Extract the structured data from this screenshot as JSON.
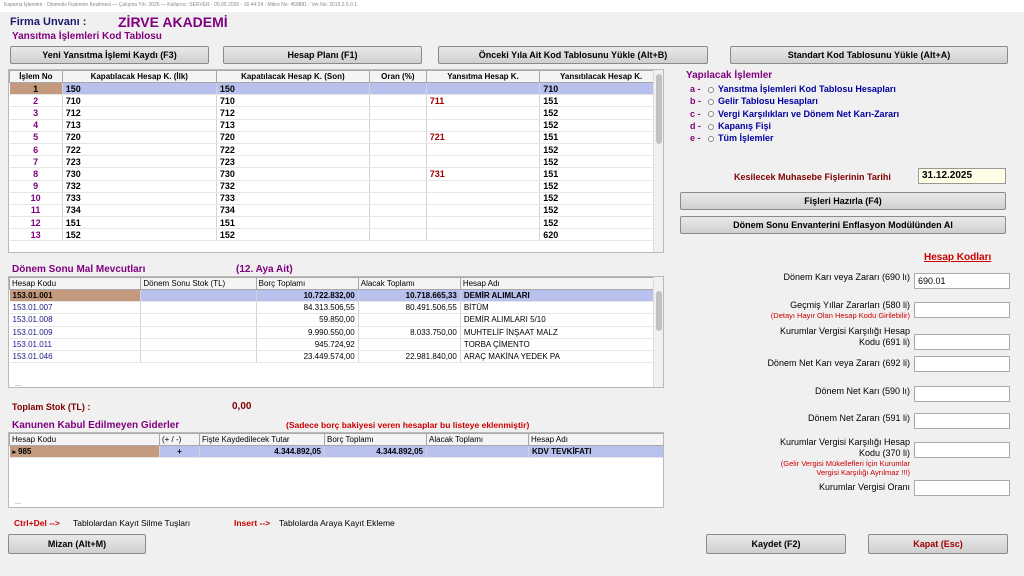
{
  "window": {
    "title": "Kapanış İşlemleri - Otomotiv Fişlerinin Kesilmesi  —  Çalışma Yılı: 2025  —  Kullanıcı: SERVER - 05.05.2026 - 16:44:24 - Mikro No: 459881 - Ver.No: 2015.2.5.0.1"
  },
  "header": {
    "firma_label": "Firma Unvanı :",
    "firma_value": "ZİRVE AKADEMİ",
    "section_title": "Yansıtma İşlemleri Kod Tablosu"
  },
  "toolbar": {
    "new_btn": "Yeni Yansıtma İşlemi Kaydı (F3)",
    "plan_btn": "Hesap Planı (F1)",
    "prev_btn": "Önceki Yıla Ait Kod Tablosunu Yükle (Alt+B)",
    "std_btn": "Standart Kod Tablosunu Yükle (Alt+A)"
  },
  "kod_tablosu": {
    "columns": [
      "İşlem No",
      "Kapatılacak Hesap K. (İlk)",
      "Kapatılacak Hesap K. (Son)",
      "Oran (%)",
      "Yansıtma Hesap K.",
      "Yansıtılacak Hesap K."
    ],
    "rows": [
      [
        "1",
        "150",
        "150",
        "",
        "",
        "710"
      ],
      [
        "2",
        "710",
        "710",
        "",
        "711",
        "151"
      ],
      [
        "3",
        "712",
        "712",
        "",
        "",
        "152"
      ],
      [
        "4",
        "713",
        "713",
        "",
        "",
        "152"
      ],
      [
        "5",
        "720",
        "720",
        "",
        "721",
        "151"
      ],
      [
        "6",
        "722",
        "722",
        "",
        "",
        "152"
      ],
      [
        "7",
        "723",
        "723",
        "",
        "",
        "152"
      ],
      [
        "8",
        "730",
        "730",
        "",
        "731",
        "151"
      ],
      [
        "9",
        "732",
        "732",
        "",
        "",
        "152"
      ],
      [
        "10",
        "733",
        "733",
        "",
        "",
        "152"
      ],
      [
        "11",
        "734",
        "734",
        "",
        "",
        "152"
      ],
      [
        "12",
        "151",
        "151",
        "",
        "",
        "152"
      ],
      [
        "13",
        "152",
        "152",
        "",
        "",
        "620"
      ]
    ]
  },
  "operations": {
    "title": "Yapılacak İşlemler",
    "items": [
      {
        "key": "a -",
        "label": "Yansıtma İşlemleri Kod Tablosu Hesapları"
      },
      {
        "key": "b -",
        "label": "Gelir Tablosu Hesapları"
      },
      {
        "key": "c -",
        "label": "Vergi Karşılıkları ve Dönem Net Karı-Zararı"
      },
      {
        "key": "d -",
        "label": "Kapanış Fişi"
      },
      {
        "key": "e -",
        "label": "Tüm İşlemler"
      }
    ]
  },
  "fis": {
    "date_label": "Kesilecek Muhasebe Fişlerinin Tarihi",
    "date_value": "31.12.2025",
    "hazirla_btn": "Fişleri Hazırla (F4)",
    "enflasyon_btn": "Dönem Sonu Envanterini Enflasyon Modülünden Al"
  },
  "mal": {
    "title": "Dönem Sonu Mal Mevcutları",
    "subtitle": "(12. Aya Ait)",
    "columns": [
      "Hesap Kodu",
      "Dönem Sonu Stok (TL)",
      "Borç Toplamı",
      "Alacak Toplamı",
      "Hesap Adı"
    ],
    "rows": [
      [
        "153.01.001",
        "",
        "10.722.832,00",
        "10.718.665,33",
        "DEMİR ALIMLARI"
      ],
      [
        "153.01.007",
        "",
        "84.313.506,55",
        "80.491.506,55",
        "BİTÜM"
      ],
      [
        "153.01.008",
        "",
        "59.850,00",
        "",
        "DEMİR ALIMLARI 5/10"
      ],
      [
        "153.01.009",
        "",
        "9.990.550,00",
        "8.033.750,00",
        "MUHTELİF İNŞAAT MALZ"
      ],
      [
        "153.01.011",
        "",
        "945.724,92",
        "",
        "TORBA ÇİMENTO"
      ],
      [
        "153.01.046",
        "",
        "23.449.574,00",
        "22.981.840,00",
        "ARAÇ MAKİNA YEDEK PA"
      ]
    ],
    "footer_marker": "...",
    "toplam_label": "Toplam Stok (TL) :",
    "toplam_value": "0,00"
  },
  "kkeg": {
    "title": "Kanunen Kabul Edilmeyen Giderler",
    "note": "(Sadece borç bakiyesi veren hesaplar bu listeye eklenmiştir)",
    "columns": [
      "Hesap Kodu",
      "(+ / -)",
      "Fişte Kaydedilecek Tutar",
      "Borç Toplamı",
      "Alacak Toplamı",
      "Hesap Adı"
    ],
    "rows": [
      [
        "985",
        "+",
        "4.344.892,05",
        "4.344.892,05",
        "",
        "KDV TEVKİFATI"
      ]
    ],
    "row_marker": "▸",
    "footer_marker": "..."
  },
  "hesap_kodlari": {
    "title": "Hesap Kodları",
    "fields": [
      {
        "label": "Dönem Karı veya Zararı (690 lı)",
        "sub": "",
        "value": "690.01"
      },
      {
        "label": "Geçmiş Yıllar Zararları (580 li)",
        "sub": "(Detayı Hayır Olan Hesap Kodu Girilebilir)",
        "value": ""
      },
      {
        "label": "Kurumlar Vergisi Karşılığı Hesap Kodu (691 li)",
        "sub": "",
        "value": ""
      },
      {
        "label": "Dönem Net Karı veya Zararı (692 li)",
        "sub": "",
        "value": ""
      },
      {
        "label": "Dönem Net Karı (590 lı)",
        "sub": "",
        "value": ""
      },
      {
        "label": "Dönem Net  Zararı (591 li)",
        "sub": "",
        "value": ""
      },
      {
        "label": "Kurumlar Vergisi Karşılığı Hesap Kodu (370 li)",
        "sub": "(Gelir Vergisi Mükellefleri İçin Kurumlar Vergisi Karşılığı Ayrılmaz !!!)",
        "value": ""
      },
      {
        "label": "Kurumlar Vergisi Oranı",
        "sub": "",
        "value": ""
      }
    ]
  },
  "hints": {
    "ctrl_key": "Ctrl+Del -->",
    "ctrl_text": "Tablolardan Kayıt Silme Tuşları",
    "ins_key": "Insert -->",
    "ins_text": "Tablolarda Araya Kayıt Ekleme"
  },
  "bottom": {
    "mizan_btn": "Mizan (Alt+M)",
    "kaydet_btn": "Kaydet (F2)",
    "kapat_btn": "Kapat (Esc)"
  },
  "colors": {
    "title_purple": "#800080",
    "selected_row": "#b8c0ee",
    "selected_cell": "#c49a7e",
    "accent_red": "#cc0000",
    "label_navy": "#0000a0"
  }
}
